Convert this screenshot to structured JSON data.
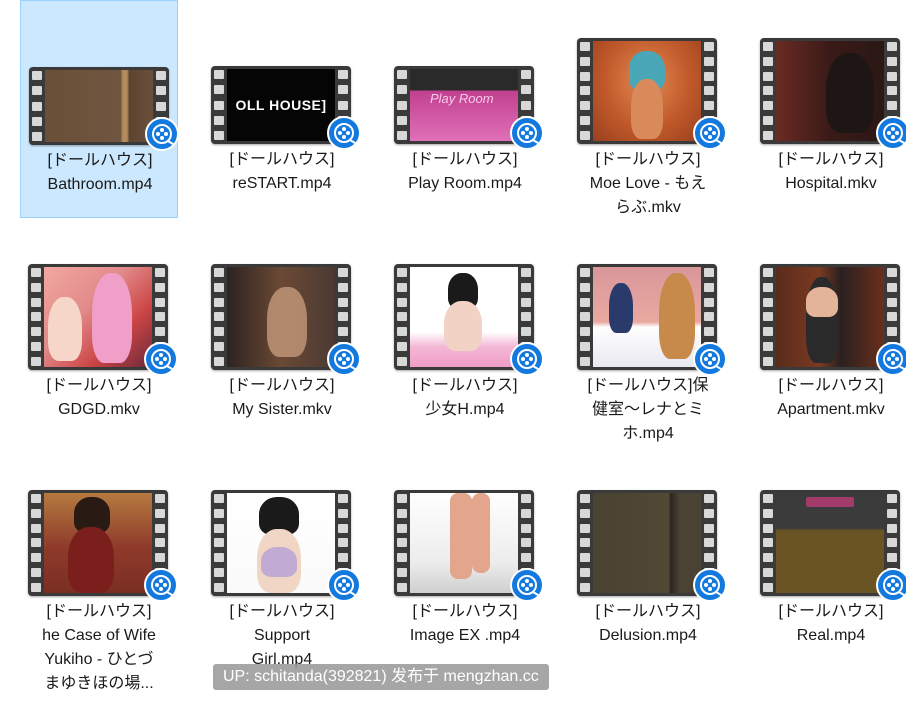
{
  "files": [
    {
      "line1": "[ドールハウス]",
      "line2": "Bathroom.mp4",
      "line3": "",
      "line4": "",
      "selected": true,
      "tall": false,
      "scene": "brown"
    },
    {
      "line1": "[ドールハウス]",
      "line2": "reSTART.mp4",
      "line3": "",
      "line4": "",
      "selected": false,
      "tall": false,
      "scene": "black",
      "thumb_text": "OLL HOUSE]"
    },
    {
      "line1": "[ドールハウス]",
      "line2": "Play Room.mp4",
      "line3": "",
      "line4": "",
      "selected": false,
      "tall": false,
      "scene": "pink",
      "thumb_text": "Play Room"
    },
    {
      "line1": "[ドールハウス]",
      "line2": "Moe Love - もえ",
      "line3": "らぶ.mkv",
      "line4": "",
      "selected": false,
      "tall": true,
      "scene": "orange"
    },
    {
      "line1": "[ドールハウス]",
      "line2": "Hospital.mkv",
      "line3": "",
      "line4": "",
      "selected": false,
      "tall": true,
      "scene": "dark"
    },
    {
      "line1": "[ドールハウス]",
      "line2": "GDGD.mkv",
      "line3": "",
      "line4": "",
      "selected": false,
      "tall": true,
      "scene": "gdgd"
    },
    {
      "line1": "[ドールハウス]",
      "line2": "My Sister.mkv",
      "line3": "",
      "line4": "",
      "selected": false,
      "tall": true,
      "scene": "sister"
    },
    {
      "line1": "[ドールハウス]",
      "line2": "少女H.mp4",
      "line3": "",
      "line4": "",
      "selected": false,
      "tall": true,
      "scene": "white"
    },
    {
      "line1": "[ドールハウス]保",
      "line2": "健室～レナとミ",
      "line3": "ホ.mp4",
      "line4": "",
      "selected": false,
      "tall": true,
      "scene": "room"
    },
    {
      "line1": "[ドールハウス]",
      "line2": "Apartment.mkv",
      "line3": "",
      "line4": "",
      "selected": false,
      "tall": true,
      "scene": "door"
    },
    {
      "line1": "[ドールハウス]",
      "line2": "he Case of Wife",
      "line3": "Yukiho - ひとづ",
      "line4": "まゆきほの場...",
      "selected": false,
      "tall": true,
      "scene": "wife"
    },
    {
      "line1": "[ドールハウス]",
      "line2": "Support",
      "line3": "Girl.mp4",
      "line4": "",
      "selected": false,
      "tall": true,
      "scene": "support"
    },
    {
      "line1": "[ドールハウス]",
      "line2": "Image EX .mp4",
      "line3": "",
      "line4": "",
      "selected": false,
      "tall": true,
      "scene": "floor"
    },
    {
      "line1": "[ドールハウス]",
      "line2": "Delusion.mp4",
      "line3": "",
      "line4": "",
      "selected": false,
      "tall": true,
      "scene": "delusion"
    },
    {
      "line1": "[ドールハウス]",
      "line2": "Real.mp4",
      "line3": "",
      "line4": "",
      "selected": false,
      "tall": true,
      "scene": "real"
    }
  ],
  "watermark": "UP: schitanda(392821) 发布于 mengzhan.cc",
  "colors": {
    "selection_bg": "#cce8ff",
    "selection_border": "#99d1ff",
    "badge": "#1479de"
  },
  "icons": {
    "file_type": "video-file-icon",
    "player_badge": "media-player-badge-icon"
  }
}
